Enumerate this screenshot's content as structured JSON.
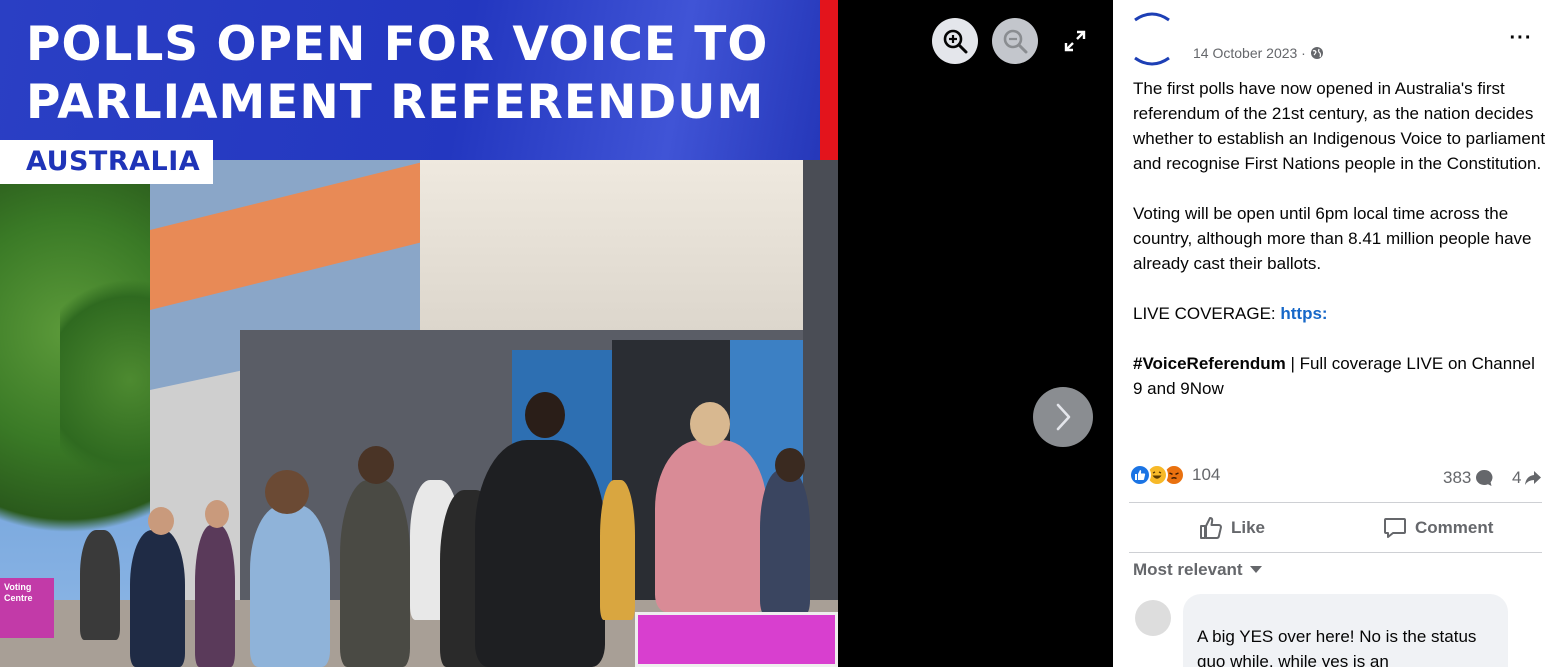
{
  "viewer": {
    "banner_title": "POLLS OPEN FOR VOICE TO PARLIAMENT REFERENDUM",
    "country_tag": "AUSTRALIA",
    "sign_text": "Voting Centre",
    "zoom_in_icon": "zoom-in-icon",
    "zoom_out_icon": "zoom-out-icon",
    "fullscreen_icon": "expand-icon",
    "next_icon": "chevron-right-icon"
  },
  "post": {
    "date": "14 October 2023 ·",
    "audience_icon": "globe-icon",
    "more_label": "···",
    "paragraph1": "The first polls have now opened in Australia's first referendum of the 21st century, as the nation decides whether to establish an Indigenous Voice to parliament and recognise First Nations people in the Constitution.",
    "paragraph2": "Voting will be open until 6pm local time across the country, although more than 8.41 million people have already cast their ballots.",
    "live_prefix": "LIVE COVERAGE: ",
    "live_link": "https:",
    "hashtag": "#VoiceReferendum",
    "hashtag_suffix": " | Full coverage LIVE on Channel 9 and 9Now"
  },
  "engagement": {
    "reaction_count": "104",
    "comment_count": "383",
    "share_count": "4",
    "like_label": "Like",
    "comment_label": "Comment",
    "sort_label": "Most relevant"
  },
  "comment": {
    "text": "A big YES over here! No is the status quo while, while yes is an"
  },
  "colors": {
    "banner_blue": "#2337c0",
    "banner_red": "#e3141c",
    "link_blue": "#1768c8",
    "secondary_text": "#65676b"
  }
}
